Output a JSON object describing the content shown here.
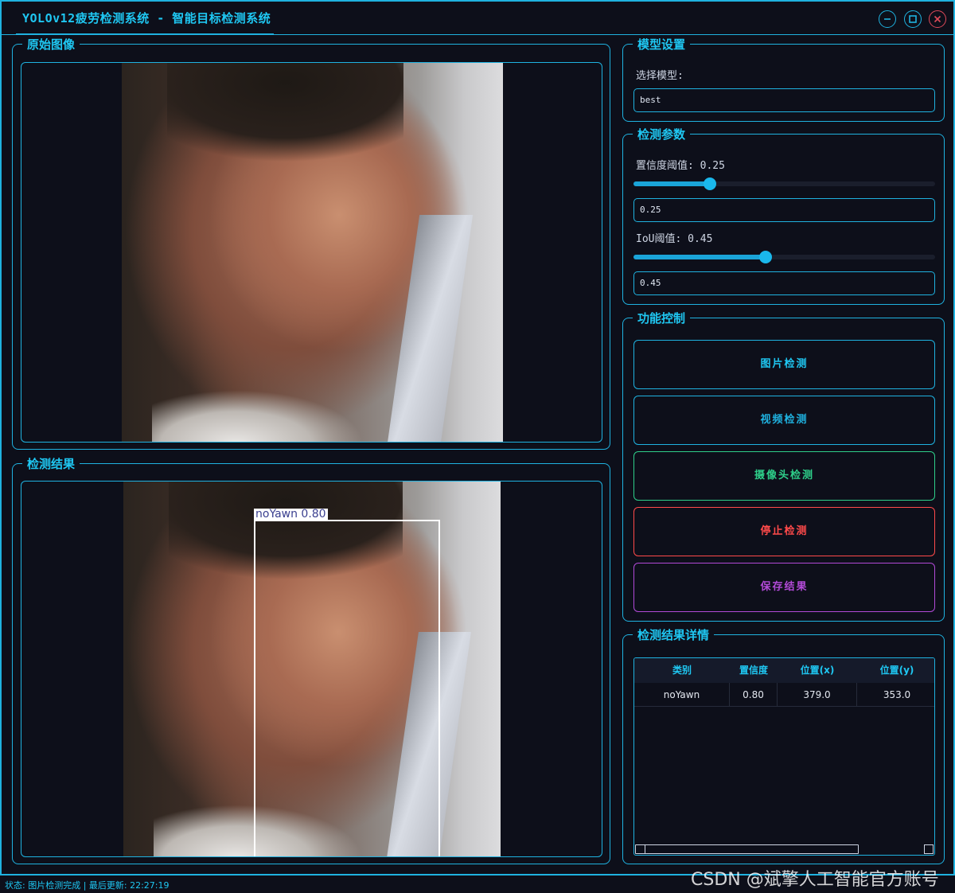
{
  "window": {
    "title": "YOLOv12疲劳检测系统 - 智能目标检测系统"
  },
  "original_panel": {
    "title": "原始图像"
  },
  "result_panel": {
    "title": "检测结果",
    "detection_label": "noYawn 0.80"
  },
  "model_settings": {
    "title": "模型设置",
    "select_label": "选择模型:",
    "selected_model": "best"
  },
  "detection_params": {
    "title": "检测参数",
    "confidence_label": "置信度阈值: 0.25",
    "confidence_value": "0.25",
    "confidence_fraction": 0.25,
    "iou_label": "IoU阈值: 0.45",
    "iou_value": "0.45",
    "iou_fraction": 0.45
  },
  "controls": {
    "title": "功能控制",
    "image_detect": "图片检测",
    "video_detect": "视频检测",
    "camera_detect": "摄像头检测",
    "stop_detect": "停止检测",
    "save_results": "保存结果"
  },
  "results_detail": {
    "title": "检测结果详情",
    "columns": [
      "类别",
      "置信度",
      "位置(x)",
      "位置(y)"
    ],
    "rows": [
      [
        "noYawn",
        "0.80",
        "379.0",
        "353.0"
      ]
    ]
  },
  "status": {
    "text": "状态: 图片检测完成 | 最后更新: 22:27:19"
  },
  "watermark": {
    "text": "CSDN @斌擎人工智能官方账号"
  },
  "colors": {
    "accent": "#1fc7f2",
    "video": "#1fb2e0",
    "camera": "#2ecf8a",
    "stop": "#ff4a4a",
    "save": "#b24ad8"
  }
}
